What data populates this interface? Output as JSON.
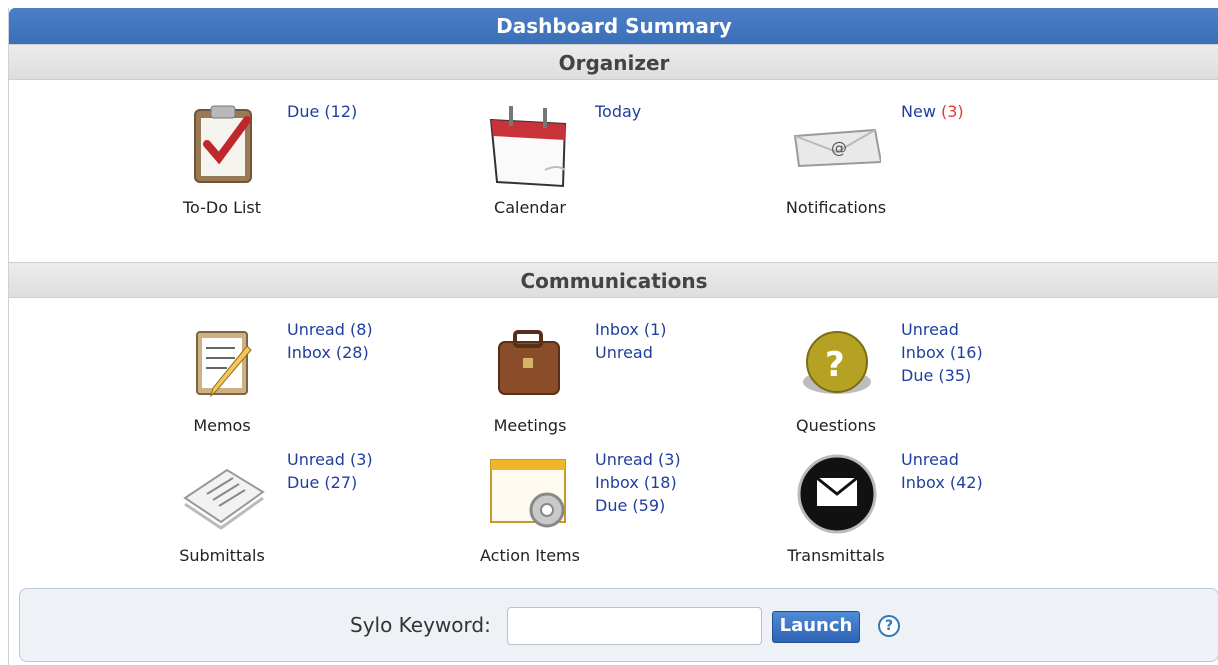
{
  "title": "Dashboard Summary",
  "sections": {
    "organizer": "Organizer",
    "communications": "Communications"
  },
  "organizer": {
    "todo": {
      "caption": "To-Do List",
      "icon": "clipboard-check-icon",
      "due": "Due (12)"
    },
    "calendar": {
      "caption": "Calendar",
      "icon": "calendar-icon",
      "today": "Today"
    },
    "notifications": {
      "caption": "Notifications",
      "icon": "envelope-at-icon",
      "new_label": "New",
      "new_count": "(3)"
    }
  },
  "communications": {
    "memos": {
      "caption": "Memos",
      "icon": "memo-pencil-icon",
      "links": [
        "Unread (8)",
        "Inbox (28)"
      ]
    },
    "meetings": {
      "caption": "Meetings",
      "icon": "briefcase-icon",
      "links": [
        "Inbox (1)",
        "Unread"
      ]
    },
    "questions": {
      "caption": "Questions",
      "icon": "question-button-icon",
      "links": [
        "Unread",
        "Inbox (16)",
        "Due (35)"
      ]
    },
    "submittals": {
      "caption": "Submittals",
      "icon": "paper-stack-icon",
      "links": [
        "Unread (3)",
        "Due (27)"
      ]
    },
    "action_items": {
      "caption": "Action Items",
      "icon": "window-gear-icon",
      "links": [
        "Unread (3)",
        "Inbox (18)",
        "Due (59)"
      ]
    },
    "transmittals": {
      "caption": "Transmittals",
      "icon": "mail-circle-icon",
      "links": [
        "Unread",
        "Inbox (42)"
      ]
    }
  },
  "footer": {
    "keyword_label": "Sylo Keyword:",
    "keyword_value": "",
    "launch_label": "Launch",
    "help": "?"
  },
  "colors": {
    "title_bar": "#3a6fb8",
    "link": "#1f3f9e",
    "alert": "#e03a3a"
  }
}
